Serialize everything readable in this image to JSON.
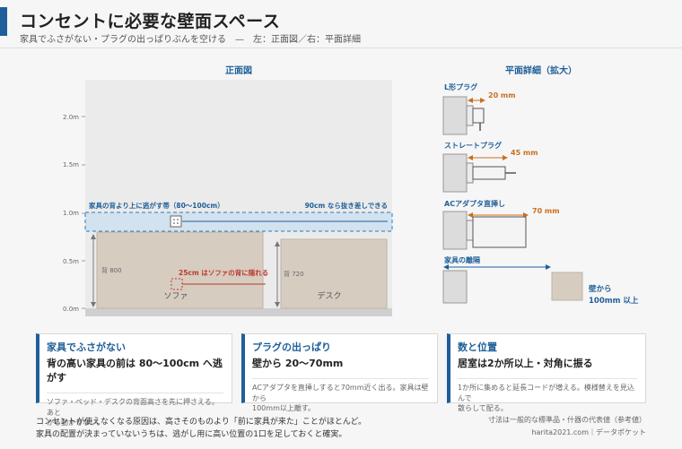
{
  "header": {
    "title": "コンセントに必要な壁面スペース",
    "subtitle": "家具でふさがない・プラグの出っぱりぶんを空ける　—　左：正面図／右：平面詳細"
  },
  "front": {
    "heading": "正面図",
    "ticks": [
      "2.0m",
      "1.5m",
      "1.0m",
      "0.5m",
      "0.0m"
    ],
    "band_label": "家具の背より上に逃がす帯（80〜100cm）",
    "band_note": "90cm なら抜き差しできる",
    "hidden_label": "25cm はソファの背に隠れる",
    "sofa": {
      "name": "ソファ",
      "height": "背 800"
    },
    "desk": {
      "name": "デスク",
      "height": "背 720"
    }
  },
  "detail": {
    "heading": "平面詳細（拡大）",
    "items": [
      {
        "name": "L形プラグ",
        "depth": "20 mm"
      },
      {
        "name": "ストレートプラグ",
        "depth": "45 mm"
      },
      {
        "name": "ACアダプタ直挿し",
        "depth": "70 mm"
      }
    ],
    "gap": {
      "name": "家具の離隔",
      "line1": "壁から",
      "line2": "100mm 以上"
    }
  },
  "cards": [
    {
      "title": "家具でふさがない",
      "lead": "背の高い家具の前は 80〜100cm へ逃がす",
      "body1": "ソファ・ベッド・デスクの背面高さを先に押さえる。あと",
      "body2": "から動かせない。"
    },
    {
      "title": "プラグの出っぱり",
      "lead": "壁から 20〜70mm",
      "body1": "ACアダプタを直挿しすると70mm近く出る。家具は壁から",
      "body2": "100mm以上離す。"
    },
    {
      "title": "数と位置",
      "lead": "居室は2か所以上・対角に振る",
      "body1": "1か所に集めると延長コードが増える。模様替えを見込んで",
      "body2": "散らして配る。"
    }
  ],
  "footer": {
    "line1": "コンセントが使えなくなる原因は、高さそのものより「前に家具が来た」ことがほとんど。",
    "line2": "家具の配置が決まっていないうちは、逃がし用に高い位置の1口を足しておくと確実。",
    "credit1": "寸法は一般的な標準品・什器の代表値（参考値）",
    "credit2": "harita2021.com｜データポケット"
  },
  "colors": {
    "accent": "#1f5f99",
    "dimension": "#c9701e",
    "warning": "#c0392b",
    "furniture": "#d6ccc0"
  }
}
